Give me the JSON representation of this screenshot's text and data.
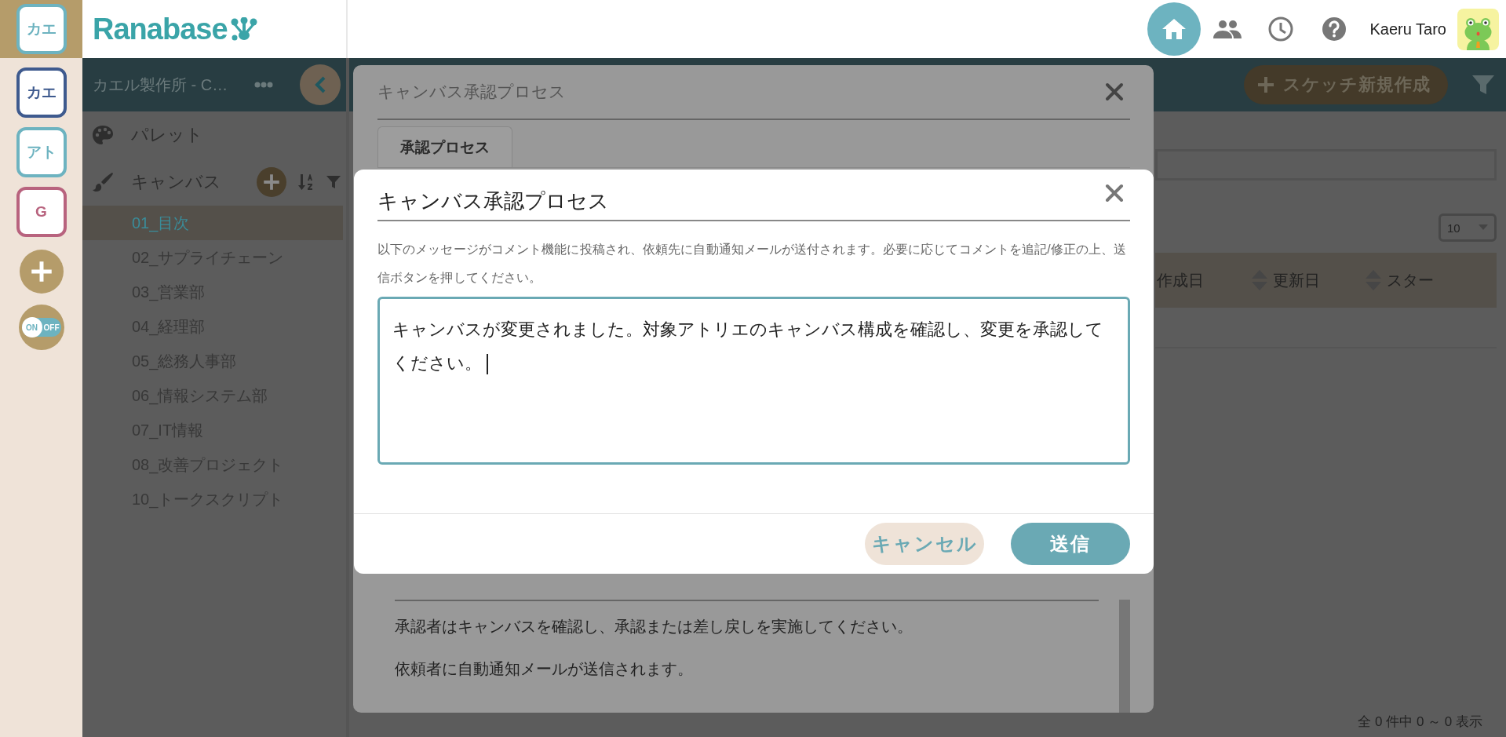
{
  "workspace_rail": {
    "items": [
      {
        "label": "カエ",
        "color": "#6db3c0",
        "selected": true
      },
      {
        "label": "カエ",
        "color": "#3e5a8e",
        "selected": false
      },
      {
        "label": "アト",
        "color": "#6db3c0",
        "selected": false
      },
      {
        "label": "G",
        "color": "#b8637e",
        "selected": false
      }
    ],
    "toggle": {
      "on_label": "ON",
      "off_label": "OFF"
    }
  },
  "header": {
    "logo": "Ranabase",
    "nav": [
      {
        "kind": "home",
        "selected": true
      },
      {
        "kind": "people",
        "selected": false
      },
      {
        "kind": "clock",
        "selected": false
      },
      {
        "kind": "help",
        "selected": false
      }
    ],
    "user_name": "Kaeru Taro"
  },
  "sidebar": {
    "title": "カエル製作所 - C…",
    "palette_label": "パレット",
    "canvas_label": "キャンバス",
    "items": [
      {
        "label": "01_目次",
        "selected": true
      },
      {
        "label": "02_サプライチェーン",
        "selected": false
      },
      {
        "label": "03_営業部",
        "selected": false
      },
      {
        "label": "04_経理部",
        "selected": false
      },
      {
        "label": "05_総務人事部",
        "selected": false
      },
      {
        "label": "06_情報システム部",
        "selected": false
      },
      {
        "label": "07_IT情報",
        "selected": false
      },
      {
        "label": "08_改善プロジェクト",
        "selected": false
      },
      {
        "label": "10_トークスクリプト",
        "selected": false
      }
    ]
  },
  "toolbar": {
    "new_button": "スケッチ新規作成"
  },
  "table": {
    "page_size": "10",
    "columns": [
      {
        "label": "作成日"
      },
      {
        "label": "更新日"
      },
      {
        "label": "スター"
      }
    ],
    "footer": "全 0 件中 0 ～ 0 表示"
  },
  "back_dialog": {
    "title": "キャンバス承認プロセス",
    "tabs": [
      {
        "label": "承認プロセス",
        "selected": true
      }
    ],
    "paragraphs": [
      "承認者はキャンバスを確認し、承認または差し戻しを実施してください。",
      "依頼者に自動通知メールが送信されます。"
    ]
  },
  "dialog": {
    "title": "キャンバス承認プロセス",
    "description": "以下のメッセージがコメント機能に投稿され、依頼先に自動通知メールが送付されます。必要に応じてコメントを追記/修正の上、送信ボタンを押してください。",
    "comment": "キャンバスが変更されました。対象アトリエのキャンバス構成を確認し、変更を承認してください。",
    "buttons": [
      {
        "label": "キャンセル",
        "kind": "secondary"
      },
      {
        "label": "送信",
        "kind": "primary"
      }
    ]
  }
}
